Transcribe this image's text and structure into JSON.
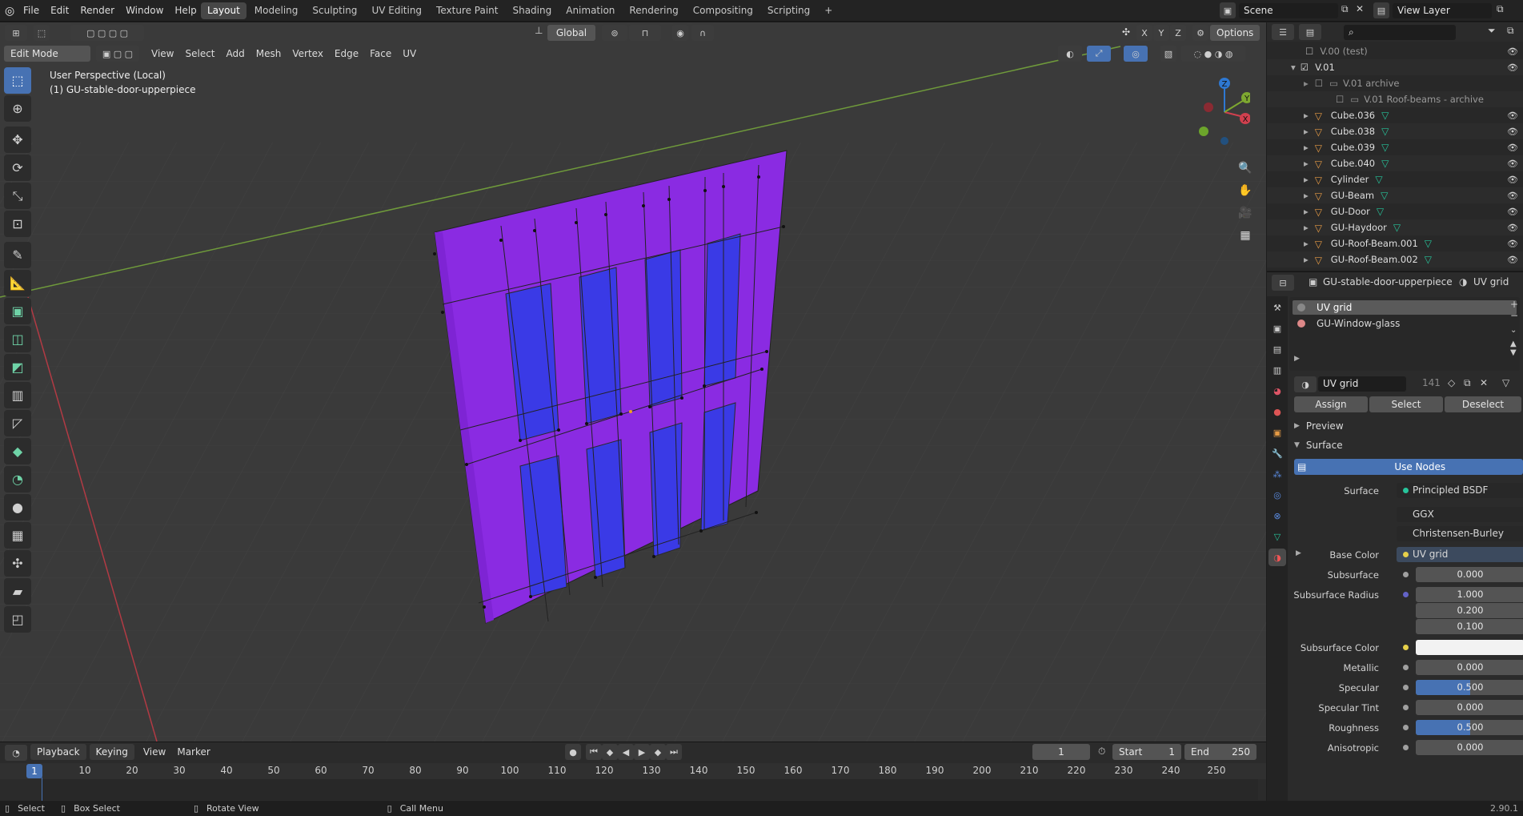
{
  "topbar": {
    "menus": [
      "File",
      "Edit",
      "Render",
      "Window",
      "Help"
    ],
    "workspaces": [
      "Layout",
      "Modeling",
      "Sculpting",
      "UV Editing",
      "Texture Paint",
      "Shading",
      "Animation",
      "Rendering",
      "Compositing",
      "Scripting"
    ],
    "active_workspace": "Layout",
    "add_tab": "+",
    "scene_label": "Scene",
    "view_layer_label": "View Layer"
  },
  "viewport": {
    "mode": "Edit Mode",
    "menus": [
      "View",
      "Select",
      "Add",
      "Mesh",
      "Vertex",
      "Edge",
      "Face",
      "UV"
    ],
    "transform_orientation": "Global",
    "axes": [
      "X",
      "Y",
      "Z"
    ],
    "options_label": "Options",
    "perspective_label": "User Perspective (Local)",
    "object_label": "(1) GU-stable-door-upperpiece",
    "gizmo": {
      "x": "X",
      "y": "Y",
      "z": "Z"
    },
    "mesh_color": "#8a2be2",
    "glass_color": "#3a3ae6"
  },
  "outliner": {
    "search_placeholder": "",
    "items": [
      {
        "label": "V.00 (test)",
        "kind": "collection",
        "indent": 0,
        "dim": true
      },
      {
        "label": "V.01",
        "kind": "collection",
        "indent": 0,
        "dim": false
      },
      {
        "label": "V.01 archive",
        "kind": "collection",
        "indent": 1,
        "dim": true
      },
      {
        "label": "V.01 Roof-beams - archive",
        "kind": "collection",
        "indent": 2,
        "dim": true
      },
      {
        "label": "Cube.036",
        "kind": "mesh",
        "indent": 1,
        "dim": false
      },
      {
        "label": "Cube.038",
        "kind": "mesh",
        "indent": 1,
        "dim": false
      },
      {
        "label": "Cube.039",
        "kind": "mesh",
        "indent": 1,
        "dim": false
      },
      {
        "label": "Cube.040",
        "kind": "mesh",
        "indent": 1,
        "dim": false
      },
      {
        "label": "Cylinder",
        "kind": "mesh",
        "indent": 1,
        "dim": false
      },
      {
        "label": "GU-Beam",
        "kind": "mesh",
        "indent": 1,
        "dim": false
      },
      {
        "label": "GU-Door",
        "kind": "mesh",
        "indent": 1,
        "dim": false
      },
      {
        "label": "GU-Haydoor",
        "kind": "mesh",
        "indent": 1,
        "dim": false
      },
      {
        "label": "GU-Roof-Beam.001",
        "kind": "mesh",
        "indent": 1,
        "dim": false
      },
      {
        "label": "GU-Roof-Beam.002",
        "kind": "mesh",
        "indent": 1,
        "dim": false
      }
    ]
  },
  "properties": {
    "object_name": "GU-stable-door-upperpiece",
    "material_name": "UV grid",
    "slots": [
      "UV grid",
      "GU-Window-glass"
    ],
    "material_field": "UV grid",
    "user_count": "141",
    "assign": "Assign",
    "select": "Select",
    "deselect": "Deselect",
    "preview": "Preview",
    "surface_section": "Surface",
    "use_nodes": "Use Nodes",
    "surface_label": "Surface",
    "surface_value": "Principled BSDF",
    "distribution": "GGX",
    "subsurface_method": "Christensen-Burley",
    "base_color_label": "Base Color",
    "base_color_value": "UV grid",
    "subsurface_label": "Subsurface",
    "subsurface_value": "0.000",
    "subsurface_radius_label": "Subsurface Radius",
    "subsurface_radius": [
      "1.000",
      "0.200",
      "0.100"
    ],
    "subsurface_color_label": "Subsurface Color",
    "metallic_label": "Metallic",
    "metallic_value": "0.000",
    "specular_label": "Specular",
    "specular_value": "0.500",
    "specular_fill": 0.5,
    "specular_tint_label": "Specular Tint",
    "specular_tint_value": "0.000",
    "roughness_label": "Roughness",
    "roughness_value": "0.500",
    "roughness_fill": 0.5,
    "anisotropic_label": "Anisotropic",
    "anisotropic_value": "0.000"
  },
  "timeline": {
    "menus": [
      "Playback",
      "Keying",
      "View",
      "Marker"
    ],
    "current_frame": "1",
    "start_label": "Start",
    "start_value": "1",
    "end_label": "End",
    "end_value": "250",
    "ruler_frames": [
      "10",
      "20",
      "30",
      "40",
      "50",
      "60",
      "70",
      "80",
      "90",
      "100",
      "110",
      "120",
      "130",
      "140",
      "150",
      "160",
      "170",
      "180",
      "190",
      "200",
      "210",
      "220",
      "230",
      "240",
      "250"
    ],
    "playhead": "1"
  },
  "statusbar": {
    "select": "Select",
    "box_select": "Box Select",
    "rotate_view": "Rotate View",
    "call_menu": "Call Menu",
    "version": "2.90.1"
  }
}
